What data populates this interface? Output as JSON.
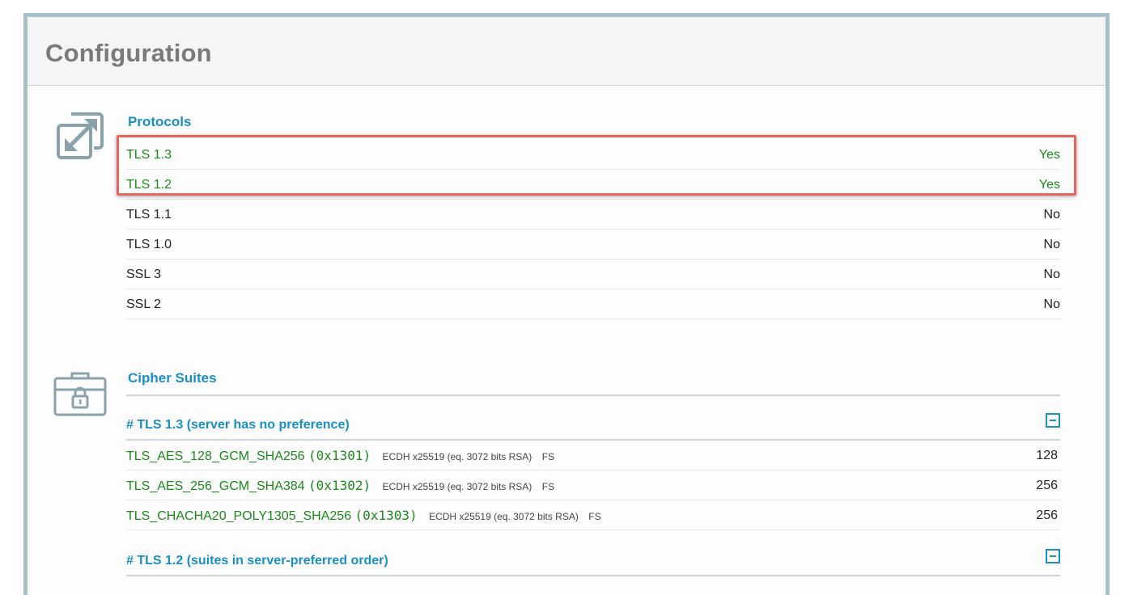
{
  "panel": {
    "title": "Configuration"
  },
  "protocols": {
    "title": "Protocols",
    "icon": "resize-arrows-icon",
    "rows": [
      {
        "label": "TLS 1.3",
        "value": "Yes",
        "status": "good"
      },
      {
        "label": "TLS 1.2",
        "value": "Yes",
        "status": "good"
      },
      {
        "label": "TLS 1.1",
        "value": "No",
        "status": "neutral"
      },
      {
        "label": "TLS 1.0",
        "value": "No",
        "status": "neutral"
      },
      {
        "label": "SSL 3",
        "value": "No",
        "status": "neutral"
      },
      {
        "label": "SSL 2",
        "value": "No",
        "status": "neutral"
      }
    ]
  },
  "cipher_suites": {
    "title": "Cipher Suites",
    "icon": "toolbox-lock-icon",
    "groups": [
      {
        "label": "# TLS 1.3 (server has no preference)",
        "suites": [
          {
            "name": "TLS_AES_128_GCM_SHA256",
            "code": "(0x1301)",
            "detail": "ECDH x25519 (eq. 3072 bits RSA)",
            "fs": "FS",
            "bits": "128"
          },
          {
            "name": "TLS_AES_256_GCM_SHA384",
            "code": "(0x1302)",
            "detail": "ECDH x25519 (eq. 3072 bits RSA)",
            "fs": "FS",
            "bits": "256"
          },
          {
            "name": "TLS_CHACHA20_POLY1305_SHA256",
            "code": "(0x1303)",
            "detail": "ECDH x25519 (eq. 3072 bits RSA)",
            "fs": "FS",
            "bits": "256"
          }
        ]
      },
      {
        "label": "# TLS 1.2 (suites in server-preferred order)",
        "suites": []
      }
    ]
  },
  "colors": {
    "section_title": "#1a8fc4",
    "good": "#1b8a1b",
    "highlight_border": "#e8645c",
    "frame_border": "#a7c3c9"
  }
}
